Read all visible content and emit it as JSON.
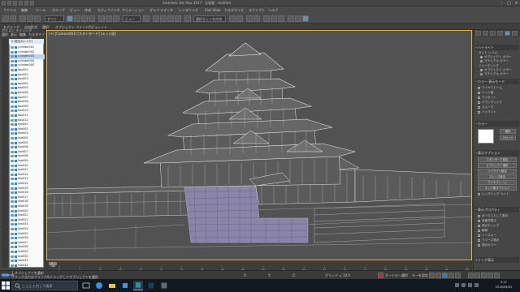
{
  "window": {
    "title": "Autodesk 3ds Max 2017 - 无标题 - Untitled"
  },
  "menu": {
    "items": [
      "ファイル",
      "編集",
      "ツール",
      "グループ",
      "ビュー",
      "作成",
      "モディファイヤ",
      "アニメーション",
      "グラフ エディタ",
      "レンダリング",
      "Civil View",
      "カスタマイズ",
      "スクリプト",
      "ヘルプ"
    ]
  },
  "toolbar": {
    "selection_filter": "すべて",
    "view_dropdown": "ビュー",
    "selection_set": "選択セットを作成"
  },
  "ribbon": {
    "items": [
      "モデリング",
      "自由形式",
      "選択",
      "オブジェクト ペイント",
      "ポピュレート"
    ]
  },
  "explorer": {
    "header": "ポリゴン モデリング",
    "tabs": [
      "選択",
      "表示",
      "編集",
      "カスタマイズ"
    ],
    "root": "0 (既定のレイヤ)",
    "items": [
      "cylinder001",
      "cylinder002",
      "cylinder003",
      "cylinder004",
      "cylinder005",
      "box001",
      "box002",
      "box003",
      "box004",
      "box005",
      "box006",
      "box007",
      "box008",
      "box009",
      "box010",
      "box011",
      "box012",
      "line001",
      "line002",
      "line003",
      "line004",
      "line005",
      "line006",
      "line007",
      "line008",
      "line009",
      "line010",
      "line011",
      "line012",
      "line013",
      "line014",
      "line015",
      "line016",
      "line017",
      "line018",
      "line019",
      "line020",
      "line021",
      "line022",
      "line023",
      "line024",
      "line025",
      "line026",
      "line027",
      "line028",
      "line029",
      "line030",
      "line031",
      "line032"
    ]
  },
  "viewport": {
    "label": "[+] [Camera001] [スタンダード] [エッジ面]"
  },
  "command_panel": {
    "rollouts": [
      {
        "title": "ハイライト",
        "y": 55
      },
      {
        "title": "カラー"
      },
      {
        "title": "パラメータ"
      },
      {
        "title": "レンダリングタイプ"
      }
    ],
    "r1_items": [
      "ライト レベル",
      "オブジェクト カラー",
      "マテリアル カラー"
    ],
    "r2_head": "シェーディング",
    "r2_items": [
      "オブジェクト カラー",
      "マテリアル カラー"
    ],
    "r3_title": "カラー 表示モード",
    "r3_items": [
      "ワイヤフレーム",
      "エッジ面",
      "ファセット",
      "バウンディング",
      "スムーズ",
      "ハイライト"
    ],
    "color_label": "カラー",
    "color_buttons": [
      "選択",
      "リセット"
    ],
    "r4_title": "表示オプション",
    "r4_buttons": [
      "スタンダード設定",
      "オブジェクト選択",
      "ハイライト設定",
      "スムーズ設定",
      "ワイヤフレーム",
      "エッジ面オプション"
    ],
    "r4_check": "レンダリング ライト",
    "r5_title": "表示プロパティ",
    "r5_items": [
      "ボックスとして表示",
      "背面非表示",
      "頂点ティック",
      "軌跡",
      "シースルー",
      "フリーズ表示",
      "頂点カラー"
    ],
    "r6_title": "リンク表示"
  },
  "timeline": {
    "frame": "0 / 100",
    "ticks": [
      "0",
      "5",
      "10",
      "15",
      "20",
      "25",
      "30",
      "35",
      "40",
      "45",
      "50",
      "55",
      "60",
      "65",
      "70",
      "75",
      "80",
      "85",
      "90",
      "95",
      "100"
    ]
  },
  "status": {
    "maxscript": "MAXScript",
    "selected": "1 オブジェクトを選択",
    "prompt": "クリックまたはクリック&ドラッグしてオブジェクトを選択",
    "x_label": "X:",
    "y_label": "Y:",
    "z_label": "Z:",
    "grid": "グリッド = 10.0",
    "autokey": "オートキー",
    "setkey": "キーを設定",
    "selected_list": "選択"
  },
  "taskbar": {
    "search_placeholder": "ここに入力して検索",
    "time": "9:47",
    "date": "2018/06/02"
  },
  "colors": {
    "viewport_bg": "#525252",
    "frame_active": "#e3b14a",
    "wire": "#e0e0e0",
    "stone": "#8a84a8",
    "taskbar": "#101820"
  }
}
